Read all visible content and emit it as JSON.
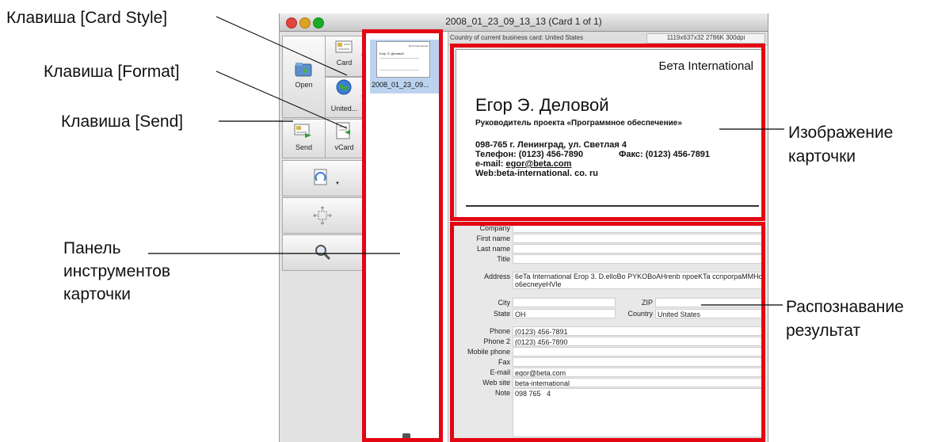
{
  "callouts": {
    "card_style": "Клавиша [Card Style]",
    "format": "Клавиша [Format]",
    "send": "Клавиша [Send]",
    "toolbar_line1": "Панель",
    "toolbar_line2": "инструментов",
    "toolbar_line3": "карточки",
    "image_line1": "Изображение",
    "image_line2": "карточки",
    "result_line1": "Распознавание",
    "result_line2": "результат"
  },
  "window": {
    "title": "2008_01_23_09_13_13 (Card 1 of 1)"
  },
  "toolbar": {
    "open_label": "Open",
    "card_label": "Card",
    "united_label": "United...",
    "send_label": "Send",
    "vcard_label": "vCard"
  },
  "thumbnail": {
    "caption": "2008_01_23_09...",
    "mini_company": "Бета International",
    "mini_name": "Егор Э. Деловой"
  },
  "info_bar": {
    "country": "Country of current business card: United States",
    "resolution": "1119x637x32  2786K  300dpi"
  },
  "card": {
    "company": "Бета International",
    "name": "Егор Э. Деловой",
    "position": "Руководитель проекта «Программное обеспечение»",
    "address": "098-765 г. Ленинград, ул. Светлая 4",
    "phone": "Телефон: (0123) 456-7890",
    "fax": "Факс: (0123) 456-7891",
    "email_prefix": "e-mail: ",
    "email": "egor@beta.com",
    "web": "Web:beta-international. co. ru"
  },
  "form": {
    "company": {
      "label": "Company",
      "value": ""
    },
    "first_name": {
      "label": "First name",
      "value": ""
    },
    "last_name": {
      "label": "Last name",
      "value": ""
    },
    "title": {
      "label": "Title",
      "value": ""
    },
    "address": {
      "label": "Address",
      "value": "6eTa International Erop 3. D.elloBo  PYKOBoAHrenb npoeKTa ccnporpaMMHoe",
      "value2": "o6ecneyeHVle"
    },
    "city": {
      "label": "City",
      "value": ""
    },
    "zip": {
      "label": "ZIP",
      "value": ""
    },
    "state": {
      "label": "State",
      "value": "OH"
    },
    "country": {
      "label": "Country",
      "value": "United States"
    },
    "phone": {
      "label": "Phone",
      "value": "(0123) 456-7891"
    },
    "phone2": {
      "label": "Phone 2",
      "value": "(0123) 456-7890"
    },
    "mobile": {
      "label": "Mobile phone",
      "value": ""
    },
    "fax": {
      "label": "Fax",
      "value": ""
    },
    "email": {
      "label": "E-mail",
      "value": "egor@beta.com"
    },
    "website": {
      "label": "Web site",
      "value": "beta-intemational"
    },
    "note": {
      "label": "Note",
      "value": "098 765   4"
    }
  },
  "colors": {
    "highlight": "#e30613",
    "selection": "#bcd3ef",
    "close": "#e0443e",
    "minimize": "#dea123",
    "zoom": "#1aab29"
  }
}
